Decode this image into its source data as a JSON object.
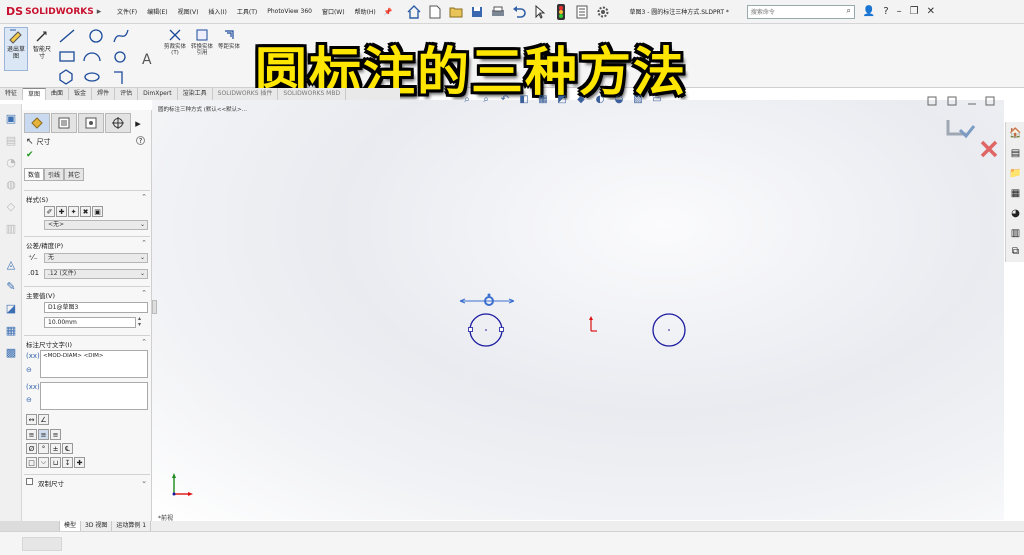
{
  "app": {
    "logo_ds": "DS",
    "logo_name": "SOLIDWORKS",
    "menu": [
      "文件(F)",
      "编辑(E)",
      "视图(V)",
      "插入(I)",
      "工具(T)",
      "PhotoView 360",
      "窗口(W)",
      "帮助(H)"
    ],
    "doc_title": "草图3 - 圆的标注三种方式.SLDPRT *",
    "search_placeholder": "搜索命令"
  },
  "ribbon": {
    "exit_sketch": "退出草图",
    "smart_dim": "智能尺寸",
    "trim": "剪裁实体(T)",
    "convert": "转换实体引用",
    "offset": "等距实体"
  },
  "headline": "圆标注的三种方法",
  "tabs": [
    "特征",
    "草图",
    "曲面",
    "钣金",
    "焊件",
    "评估",
    "DimXpert",
    "渲染工具",
    "SOLIDWORKS 插件",
    "SOLIDWORKS MBD"
  ],
  "breadcrumb": "圆的标注三种方式 (默认<<默认>...",
  "pm": {
    "title": "尺寸",
    "subtabs": [
      "数值",
      "引线",
      "其它"
    ],
    "style_title": "样式(S)",
    "style_value": "<无>",
    "tol_title": "公差/精度(P)",
    "tol_value": "无",
    "precision_value": ".12 (文件)",
    "primary_title": "主要值(V)",
    "primary_name": "D1@草图3",
    "primary_value": "10.00mm",
    "dimtext_title": "标注尺寸文字(I)",
    "dimtext_value": "<MOD-DIAM> <DIM>",
    "dual_label": "双制尺寸"
  },
  "bottom_tabs": [
    "模型",
    "3D 视图",
    "运动算例 1"
  ],
  "iso_label": "*前视",
  "colors": {
    "headline": "#ffe600",
    "sketch": "#1a1aa0",
    "brand": "#c8102e"
  }
}
